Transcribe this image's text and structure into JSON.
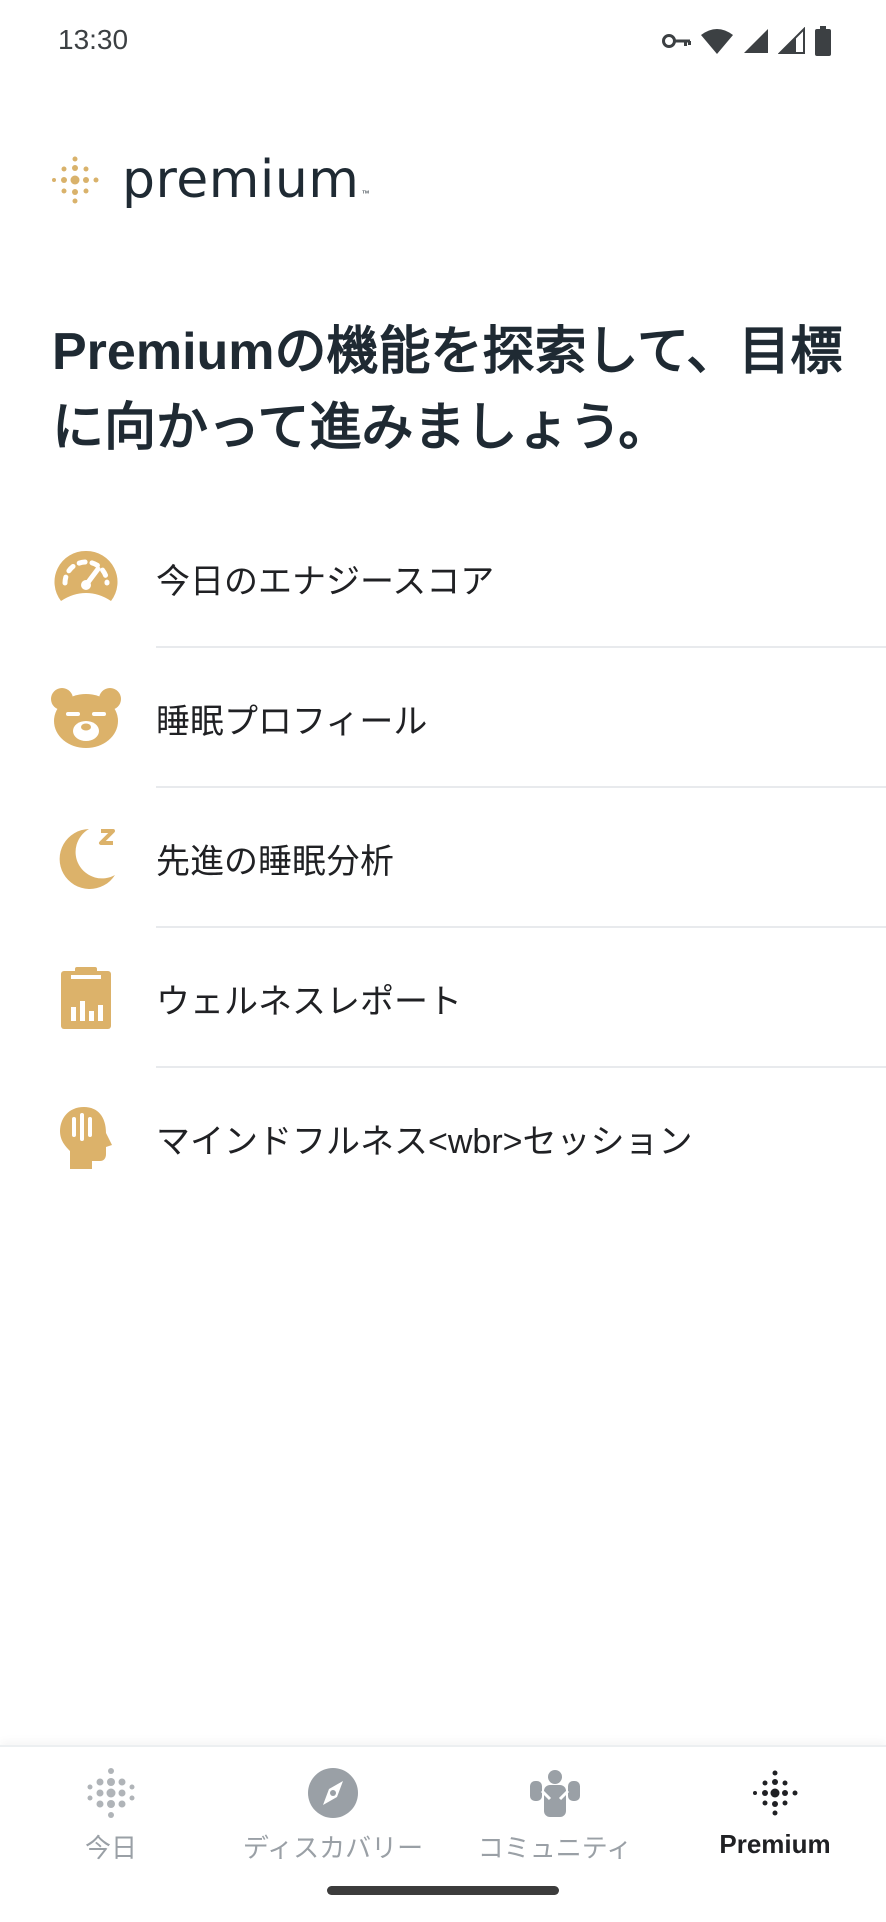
{
  "status_bar": {
    "time": "13:30",
    "icons": [
      "vpn-key-icon",
      "wifi-icon",
      "signal-icon",
      "signal-icon",
      "battery-icon"
    ]
  },
  "logo": {
    "text": "premium",
    "tm": "™",
    "accent_color": "#d9b26b"
  },
  "headline": "Premiumの機能を探索して、目標に向かって進みましょう。",
  "features": [
    {
      "label": "今日のエナジースコア",
      "icon": "gauge-icon"
    },
    {
      "label": "睡眠プロフィール",
      "icon": "bear-icon"
    },
    {
      "label": "先進の睡眠分析",
      "icon": "moon-zzz-icon"
    },
    {
      "label": "ウェルネスレポート",
      "icon": "clipboard-chart-icon"
    },
    {
      "label": "マインドフルネス<wbr>セッション",
      "icon": "mindful-head-icon"
    }
  ],
  "colors": {
    "accent": "#dcb26a",
    "text": "#202124",
    "nav_inactive": "#9aa0a6"
  },
  "bottom_nav": {
    "items": [
      {
        "label": "今日",
        "icon": "fitbit-dots-icon",
        "active": false
      },
      {
        "label": "ディスカバリー",
        "icon": "compass-icon",
        "active": false
      },
      {
        "label": "コミュニティ",
        "icon": "community-icon",
        "active": false
      },
      {
        "label": "Premium",
        "icon": "premium-dots-icon",
        "active": true
      }
    ]
  }
}
